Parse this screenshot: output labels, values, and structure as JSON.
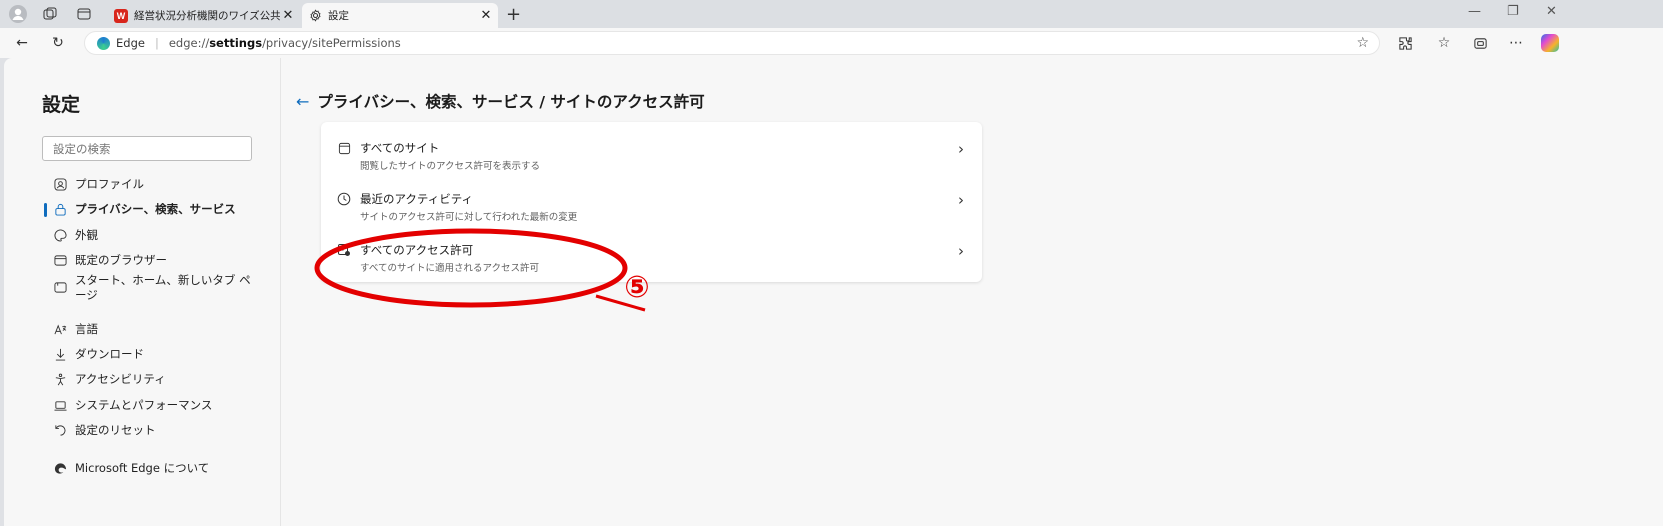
{
  "browser": {
    "tabs": [
      {
        "title": "経営状況分析機関のワイズ公共デー",
        "favicon": "w-logo-icon",
        "active": false
      },
      {
        "title": "設定",
        "favicon": "gear-icon",
        "active": true
      }
    ],
    "address_brand": "Edge",
    "address_url_prefix": "edge://",
    "address_url_bold": "settings",
    "address_url_suffix": "/privacy/sitePermissions"
  },
  "sidebar": {
    "title": "設定",
    "search_placeholder": "設定の検索",
    "items": [
      {
        "label": "プロファイル",
        "icon": "profile-icon"
      },
      {
        "label": "プライバシー、検索、サービス",
        "icon": "lock-icon",
        "active": true
      },
      {
        "label": "外観",
        "icon": "appearance-icon"
      },
      {
        "label": "既定のブラウザー",
        "icon": "browser-icon"
      },
      {
        "label": "スタート、ホーム、新しいタブ ペ",
        "label2": "ージ",
        "icon": "home-icon"
      },
      {
        "label": "言語",
        "icon": "language-icon"
      },
      {
        "label": "ダウンロード",
        "icon": "download-icon"
      },
      {
        "label": "アクセシビリティ",
        "icon": "accessibility-icon"
      },
      {
        "label": "システムとパフォーマンス",
        "icon": "laptop-icon"
      },
      {
        "label": "設定のリセット",
        "icon": "reset-icon"
      },
      {
        "label": "Microsoft Edge について",
        "icon": "edge-icon"
      }
    ]
  },
  "main": {
    "heading": "プライバシー、検索、サービス / サイトのアクセス許可",
    "rows": [
      {
        "title": "すべてのサイト",
        "subtitle": "閲覧したサイトのアクセス許可を表示する",
        "icon": "site-icon"
      },
      {
        "title": "最近のアクティビティ",
        "subtitle": "サイトのアクセス許可に対して行われた最新の変更",
        "icon": "clock-icon"
      },
      {
        "title": "すべてのアクセス許可",
        "subtitle": "すべてのサイトに適用されるアクセス許可",
        "icon": "permissions-icon"
      }
    ]
  },
  "annotation": {
    "label": "⑤",
    "color": "#e30000"
  }
}
